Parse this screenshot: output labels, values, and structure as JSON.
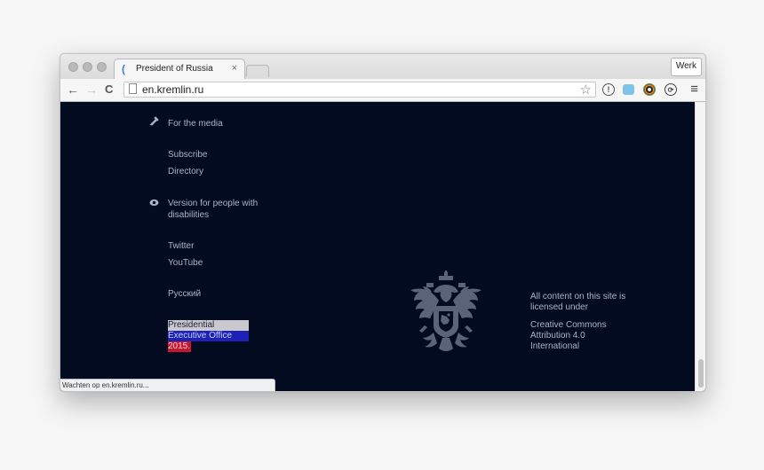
{
  "browser": {
    "tab_title": "President of Russia",
    "tab_close": "×",
    "profile_label": "Werk",
    "url": "en.kremlin.ru",
    "status_text": "Wachten op en.kremlin.ru...",
    "icons": {
      "back": "←",
      "forward": "→",
      "reload": "C",
      "star": "☆",
      "menu": "≡"
    }
  },
  "page": {
    "nav": [
      {
        "label": "For the media",
        "icon": "pen-icon"
      },
      {
        "label": "Subscribe"
      },
      {
        "label": "Directory"
      },
      {
        "label": "Version for people with disabilities",
        "icon": "eye-icon"
      },
      {
        "label": "Twitter"
      },
      {
        "label": "YouTube"
      },
      {
        "label": "Русский"
      }
    ],
    "copyright": {
      "line1": "Presidential",
      "line2": "Executive Office",
      "line3": "2015."
    },
    "license": {
      "text": "All content on this site is licensed under",
      "link": "Creative Commons Attribution 4.0 International"
    },
    "colors": {
      "background": "#030b21",
      "text": "#aab3c8",
      "flag_white": "#c9c9cf",
      "flag_blue": "#1e22b4",
      "flag_red": "#c6172e"
    }
  }
}
